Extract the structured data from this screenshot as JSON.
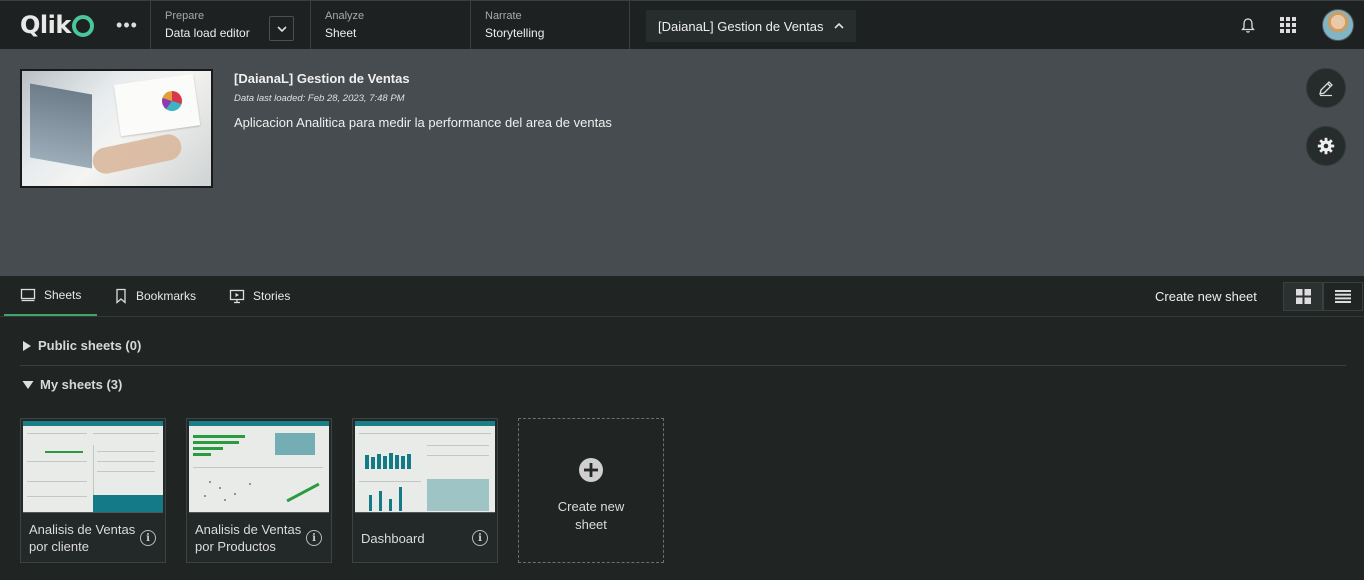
{
  "topbar": {
    "logo": "Qlik",
    "more_icon": "ellipsis-icon",
    "prepare": {
      "label": "Prepare",
      "value": "Data load editor"
    },
    "analyze": {
      "label": "Analyze",
      "value": "Sheet"
    },
    "narrate": {
      "label": "Narrate",
      "value": "Storytelling"
    },
    "app_title": "[DaianaL] Gestion de Ventas",
    "icons": [
      "bell-icon",
      "apps-grid-icon",
      "avatar"
    ]
  },
  "header": {
    "app_name": "[DaianaL] Gestion de Ventas",
    "data_loaded": "Data last loaded: Feb 28, 2023, 7:48 PM",
    "description": "Aplicacion Analitica para medir la performance del area de ventas"
  },
  "tabs": [
    {
      "label": "Sheets",
      "icon": "sheet-icon",
      "active": true
    },
    {
      "label": "Bookmarks",
      "icon": "bookmark-icon",
      "active": false
    },
    {
      "label": "Stories",
      "icon": "stories-icon",
      "active": false
    }
  ],
  "create_new_sheet_link": "Create new sheet",
  "sections": {
    "public": "Public sheets (0)",
    "mine": "My sheets (3)"
  },
  "sheets": [
    {
      "title": "Analisis de Ventas por cliente"
    },
    {
      "title": "Analisis de Ventas por Productos"
    },
    {
      "title": "Dashboard"
    }
  ],
  "new_sheet_card": "Create new sheet",
  "colors": {
    "accent": "#3fa46a",
    "teal": "#157a88",
    "header_bg": "#464c4f",
    "bg": "#202524"
  }
}
